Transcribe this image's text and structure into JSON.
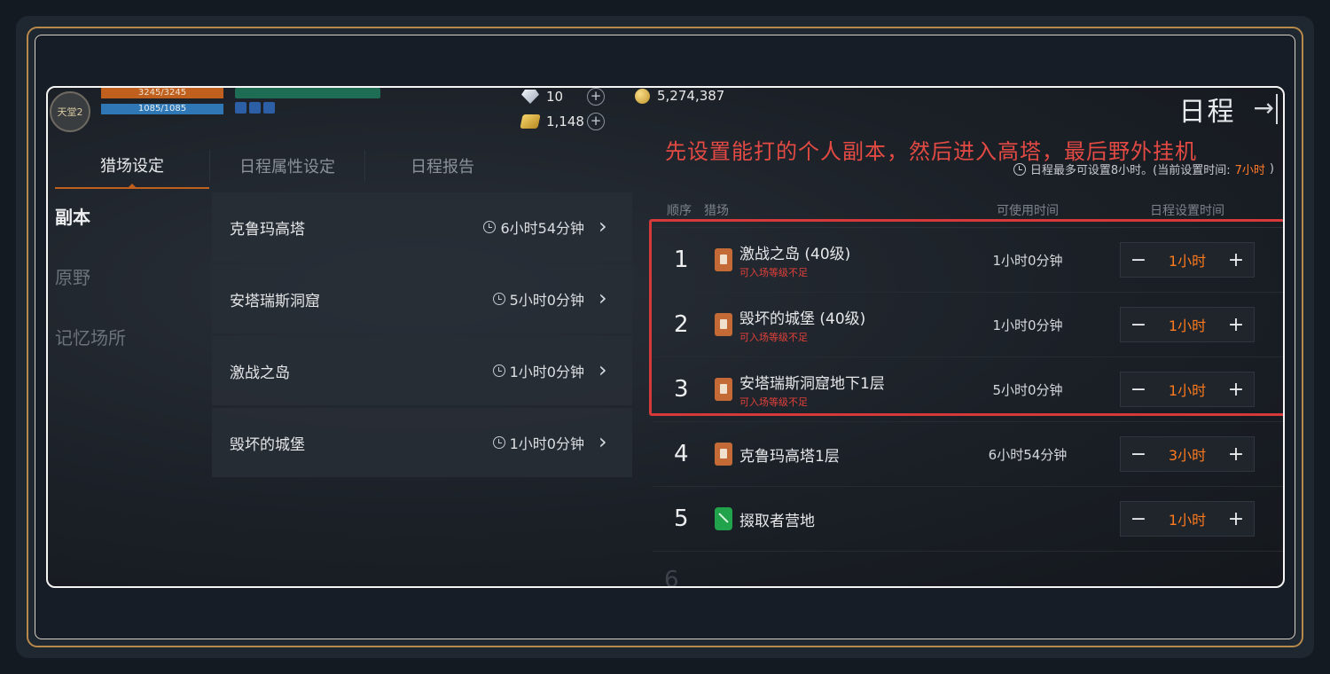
{
  "header": {
    "avatar_label": "天堂2",
    "hp": "3245/3245",
    "mp": "1085/1085",
    "currencies": [
      {
        "icon": "diamond-icon",
        "value": "10"
      },
      {
        "icon": "gold-bar-icon",
        "value": "1,148"
      },
      {
        "icon": "gold-coin-icon",
        "value": "5,274,387"
      }
    ],
    "title": "日程",
    "exit_glyph": "→"
  },
  "annotation": "先设置能打的个人副本，然后进入高塔，最后野外挂机",
  "limit_note": {
    "prefix": "日程最多可设置8小时。(当前设置时间:",
    "current": "7小时",
    "suffix": ")"
  },
  "tabs": [
    {
      "label": "猎场设定",
      "active": true
    },
    {
      "label": "日程属性设定",
      "active": false
    },
    {
      "label": "日程报告",
      "active": false
    }
  ],
  "side_nav": [
    {
      "label": "副本",
      "active": true
    },
    {
      "label": "原野",
      "active": false
    },
    {
      "label": "记忆场所",
      "active": false
    }
  ],
  "dungeons": [
    {
      "name": "克鲁玛高塔",
      "time": "6小时54分钟"
    },
    {
      "name": "安塔瑞斯洞窟",
      "time": "5小时0分钟"
    },
    {
      "name": "激战之岛",
      "time": "1小时0分钟"
    },
    {
      "name": "毁坏的城堡",
      "time": "1小时0分钟"
    }
  ],
  "schedule": {
    "headers": {
      "order": "顺序",
      "zone": "猎场",
      "available": "可使用时间",
      "set": "日程设置时间"
    },
    "rows": [
      {
        "order": "1",
        "zone": "激战之岛 (40级)",
        "warning": "可入场等级不足",
        "available": "1小时0分钟",
        "set": "1小时",
        "icon": "dungeon-icon"
      },
      {
        "order": "2",
        "zone": "毁坏的城堡 (40级)",
        "warning": "可入场等级不足",
        "available": "1小时0分钟",
        "set": "1小时",
        "icon": "dungeon-icon"
      },
      {
        "order": "3",
        "zone": "安塔瑞斯洞窟地下1层",
        "warning": "可入场等级不足",
        "available": "5小时0分钟",
        "set": "1小时",
        "icon": "dungeon-icon"
      },
      {
        "order": "4",
        "zone": "克鲁玛高塔1层",
        "warning": "",
        "available": "6小时54分钟",
        "set": "3小时",
        "icon": "dungeon-icon"
      },
      {
        "order": "5",
        "zone": "掇取者营地",
        "warning": "",
        "available": "",
        "set": "1小时",
        "icon": "field-icon"
      }
    ],
    "partial_order": "6"
  },
  "colors": {
    "accent": "#c0601e",
    "warning": "#e2403a",
    "highlight": "#d6393a",
    "value": "#ff7a1e"
  }
}
